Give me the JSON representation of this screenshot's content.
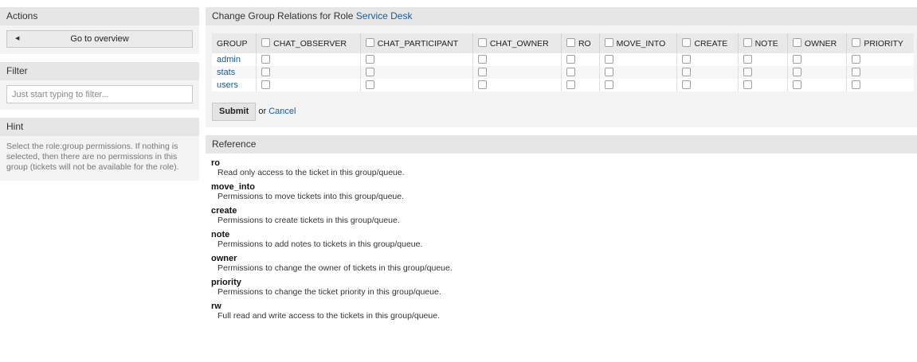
{
  "sidebar": {
    "actions": {
      "header": "Actions",
      "overview_label": "Go to overview"
    },
    "filter": {
      "header": "Filter",
      "placeholder": "Just start typing to filter..."
    },
    "hint": {
      "header": "Hint",
      "text": "Select the role:group permissions. If nothing is selected, then there are no permissions in this group (tickets will not be available for the role)."
    }
  },
  "main": {
    "title_prefix": "Change Group Relations for Role",
    "role_name": "Service Desk",
    "group_header": "GROUP",
    "columns": [
      "CHAT_OBSERVER",
      "CHAT_PARTICIPANT",
      "CHAT_OWNER",
      "RO",
      "MOVE_INTO",
      "CREATE",
      "NOTE",
      "OWNER",
      "PRIORITY"
    ],
    "groups": [
      "admin",
      "stats",
      "users"
    ],
    "submit_label": "Submit",
    "or_text": "or",
    "cancel_label": "Cancel"
  },
  "reference": {
    "header": "Reference",
    "items": [
      {
        "term": "ro",
        "desc": "Read only access to the ticket in this group/queue."
      },
      {
        "term": "move_into",
        "desc": "Permissions to move tickets into this group/queue."
      },
      {
        "term": "create",
        "desc": "Permissions to create tickets in this group/queue."
      },
      {
        "term": "note",
        "desc": "Permissions to add notes to tickets in this group/queue."
      },
      {
        "term": "owner",
        "desc": "Permissions to change the owner of tickets in this group/queue."
      },
      {
        "term": "priority",
        "desc": "Permissions to change the ticket priority in this group/queue."
      },
      {
        "term": "rw",
        "desc": "Full read and write access to the tickets in this group/queue."
      }
    ]
  }
}
